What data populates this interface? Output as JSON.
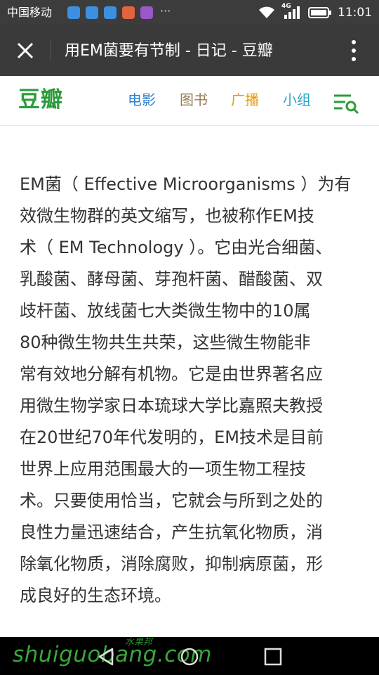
{
  "status_bar": {
    "carrier": "中国移动",
    "more": "···",
    "network": "4G",
    "time": "11:01",
    "notification_icons": [
      {
        "name": "qq-notification-icon",
        "color": "#3d8fe0"
      },
      {
        "name": "message-notification-icon",
        "color": "#3d8fe0"
      },
      {
        "name": "qq-notification-icon-2",
        "color": "#3d8fe0"
      },
      {
        "name": "app-notification-icon",
        "color": "#e0643d"
      },
      {
        "name": "calendar-notification-icon",
        "color": "#9a57c8"
      }
    ]
  },
  "app_bar": {
    "title": "用EM菌要有节制 - 日记 - 豆瓣"
  },
  "douban_nav": {
    "logo": "豆瓣",
    "links": [
      {
        "label": "电影",
        "color": "#2f7fd0"
      },
      {
        "label": "图书",
        "color": "#9a7b57"
      },
      {
        "label": "广播",
        "color": "#e59a10"
      },
      {
        "label": "小组",
        "color": "#2aa6c8"
      }
    ],
    "accent": "#2b9c3a"
  },
  "article": {
    "lines": [
      "EM菌（ Effective Microorganisms ）为有",
      "效微生物群的英文缩写，也被称作EM技",
      "术（ EM Technology ）。它由光合细菌、",
      "乳酸菌、酵母菌、芽孢杆菌、醋酸菌、双",
      "歧杆菌、放线菌七大类微生物中的10属",
      "80种微生物共生共荣，这些微生物能非",
      "常有效地分解有机物。它是由世界著名应",
      "用微生物学家日本琉球大学比嘉照夫教授",
      "在20世纪70年代发明的，EM技术是目前",
      "世界上应用范围最大的一项生物工程技",
      "术。只要使用恰当，它就会与所到之处的",
      "良性力量迅速结合，产生抗氧化物质，消",
      "除氧化物质，消除腐败，抑制病原菌，形",
      "成良好的生态环境。"
    ]
  },
  "watermark": {
    "text": "shuiguobang.com",
    "sub": "水果邦"
  }
}
